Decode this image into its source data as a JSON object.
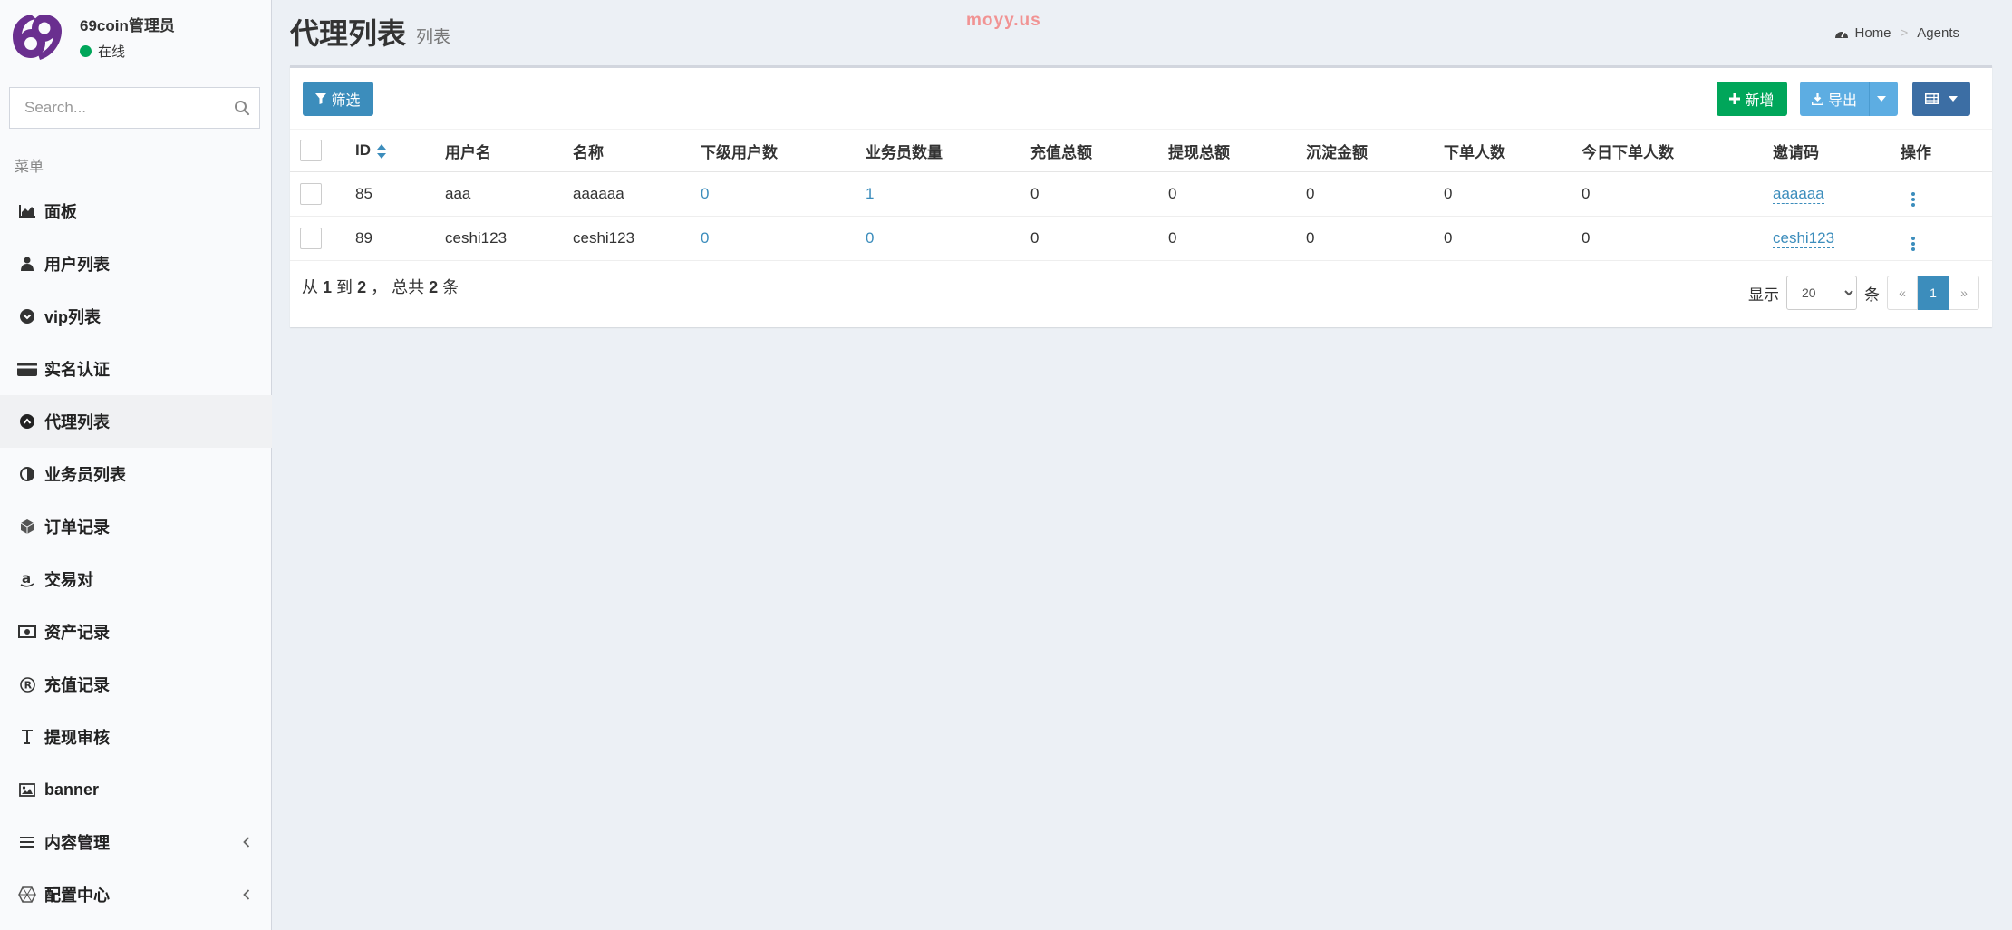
{
  "app": {
    "user_name": "69coin管理员",
    "status": "在线",
    "watermark": "moyy.us"
  },
  "colors": {
    "primary": "#3c8dbc",
    "success": "#00a65a",
    "export": "#5dade2",
    "columns": "#3c6ea4",
    "status_online": "#00a65a",
    "logo": "#6a2f8f"
  },
  "search": {
    "placeholder": "Search..."
  },
  "sidebar": {
    "menu_header": "菜单",
    "items": [
      {
        "label": "面板",
        "icon": "area-chart-icon"
      },
      {
        "label": "用户列表",
        "icon": "user-icon"
      },
      {
        "label": "vip列表",
        "icon": "chevron-circle-down-icon"
      },
      {
        "label": "实名认证",
        "icon": "credit-card-icon"
      },
      {
        "label": "代理列表",
        "icon": "arrow-circle-up-icon",
        "active": true
      },
      {
        "label": "业务员列表",
        "icon": "adjust-icon"
      },
      {
        "label": "订单记录",
        "icon": "cube-icon"
      },
      {
        "label": "交易对",
        "icon": "amazon-icon"
      },
      {
        "label": "资产记录",
        "icon": "money-icon"
      },
      {
        "label": "充值记录",
        "icon": "registered-icon"
      },
      {
        "label": "提现审核",
        "icon": "text-height-icon"
      },
      {
        "label": "banner",
        "icon": "image-icon"
      },
      {
        "label": "内容管理",
        "icon": "list-icon",
        "has_submenu": true
      },
      {
        "label": "配置中心",
        "icon": "cogs-icon",
        "has_submenu": true
      }
    ]
  },
  "header": {
    "title": "代理列表",
    "subtitle": "列表",
    "breadcrumb": {
      "home": "Home",
      "current": "Agents"
    }
  },
  "toolbar": {
    "filter_label": "筛选",
    "add_label": "新增",
    "export_label": "导出"
  },
  "table": {
    "columns": [
      "ID",
      "用户名",
      "名称",
      "下级用户数",
      "业务员数量",
      "充值总额",
      "提现总额",
      "沉淀金额",
      "下单人数",
      "今日下单人数",
      "邀请码",
      "操作"
    ],
    "rows": [
      {
        "id": "85",
        "username": "aaa",
        "name": "aaaaaa",
        "sub_users": "0",
        "salesmen": "1",
        "recharge": "0",
        "withdraw": "0",
        "deposit": "0",
        "order_users": "0",
        "today_order_users": "0",
        "invite_code": "aaaaaa"
      },
      {
        "id": "89",
        "username": "ceshi123",
        "name": "ceshi123",
        "sub_users": "0",
        "salesmen": "0",
        "recharge": "0",
        "withdraw": "0",
        "deposit": "0",
        "order_users": "0",
        "today_order_users": "0",
        "invite_code": "ceshi123"
      }
    ]
  },
  "pager": {
    "from_label": "从",
    "from": "1",
    "to_label": "到",
    "to": "2",
    "total_label": "，  总共",
    "total": "2",
    "unit": "条",
    "show_label": "显示",
    "page_size": "20",
    "per_unit": "条",
    "prev": "«",
    "current_page": "1",
    "next": "»"
  }
}
